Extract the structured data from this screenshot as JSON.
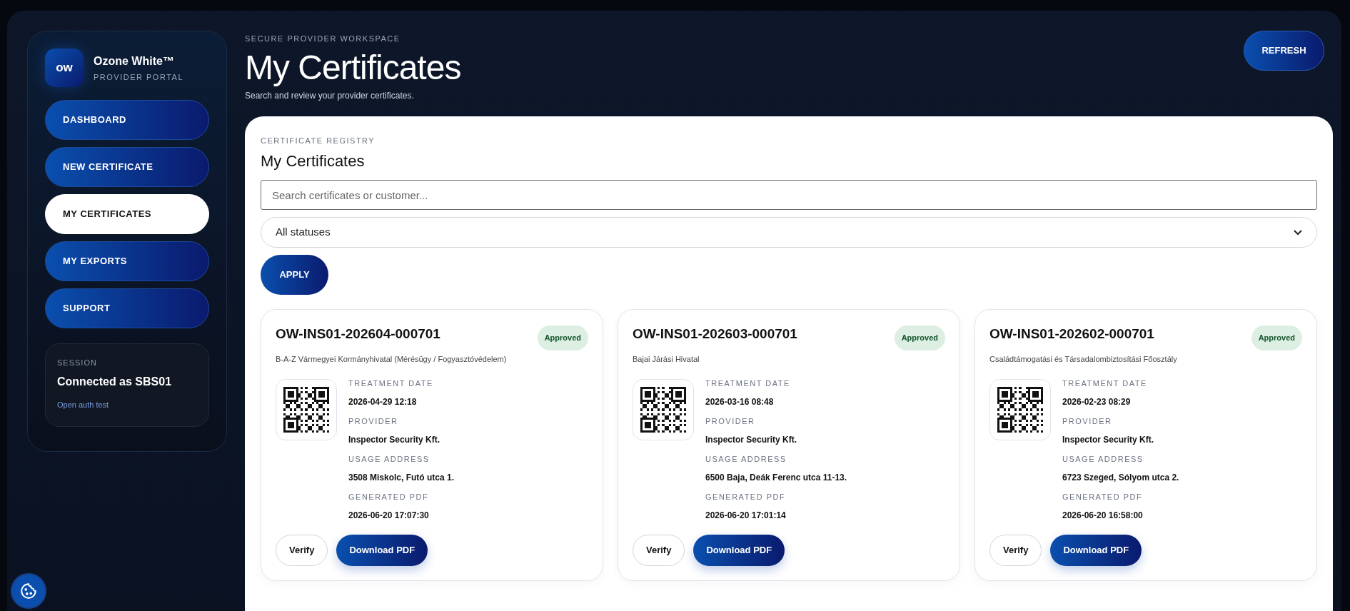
{
  "brand": {
    "logo": "ow",
    "name": "Ozone White™",
    "subtitle": "PROVIDER PORTAL"
  },
  "nav": [
    {
      "label": "DASHBOARD",
      "selected": false
    },
    {
      "label": "NEW CERTIFICATE",
      "selected": false
    },
    {
      "label": "MY CERTIFICATES",
      "selected": true
    },
    {
      "label": "MY EXPORTS",
      "selected": false
    },
    {
      "label": "SUPPORT",
      "selected": false
    }
  ],
  "session": {
    "label": "SESSION",
    "user": "Connected as SBS01",
    "link": "Open auth test"
  },
  "header": {
    "eyebrow": "SECURE PROVIDER WORKSPACE",
    "title": "My Certificates",
    "subtitle": "Search and review your provider certificates.",
    "refresh": "REFRESH"
  },
  "registry": {
    "eyebrow": "CERTIFICATE REGISTRY",
    "title": "My Certificates",
    "search": {
      "placeholder": "Search certificates or customer..."
    },
    "status_filter": {
      "value": "All statuses"
    },
    "apply": "APPLY"
  },
  "certificates": [
    {
      "id": "OW-INS01-202604-000701",
      "status": "Approved",
      "customer": "B-A-Z Vármegyei Kormányhivatal (Mérésügy / Fogyasztóvédelem)",
      "fields": [
        {
          "label": "TREATMENT DATE",
          "value": "2026-04-29 12:18"
        },
        {
          "label": "PROVIDER",
          "value": "Inspector Security Kft."
        },
        {
          "label": "USAGE ADDRESS",
          "value": "3508 Miskolc, Futó utca 1."
        },
        {
          "label": "GENERATED PDF",
          "value": "2026-06-20 17:07:30"
        }
      ],
      "actions": [
        "Verify",
        "Download PDF"
      ]
    },
    {
      "id": "OW-INS01-202603-000701",
      "status": "Approved",
      "customer": "Bajai Járási Hivatal",
      "fields": [
        {
          "label": "TREATMENT DATE",
          "value": "2026-03-16 08:48"
        },
        {
          "label": "PROVIDER",
          "value": "Inspector Security Kft."
        },
        {
          "label": "USAGE ADDRESS",
          "value": "6500 Baja, Deák Ferenc utca 11-13."
        },
        {
          "label": "GENERATED PDF",
          "value": "2026-06-20 17:01:14"
        }
      ],
      "actions": [
        "Verify",
        "Download PDF"
      ]
    },
    {
      "id": "OW-INS01-202602-000701",
      "status": "Approved",
      "customer": "Családtámogatási és Társadalombiztosítási Főosztály",
      "fields": [
        {
          "label": "TREATMENT DATE",
          "value": "2026-02-23 08:29"
        },
        {
          "label": "PROVIDER",
          "value": "Inspector Security Kft."
        },
        {
          "label": "USAGE ADDRESS",
          "value": "6723 Szeged, Sólyom utca 2."
        },
        {
          "label": "GENERATED PDF",
          "value": "2026-06-20 16:58:00"
        }
      ],
      "actions": [
        "Verify",
        "Download PDF"
      ]
    }
  ]
}
